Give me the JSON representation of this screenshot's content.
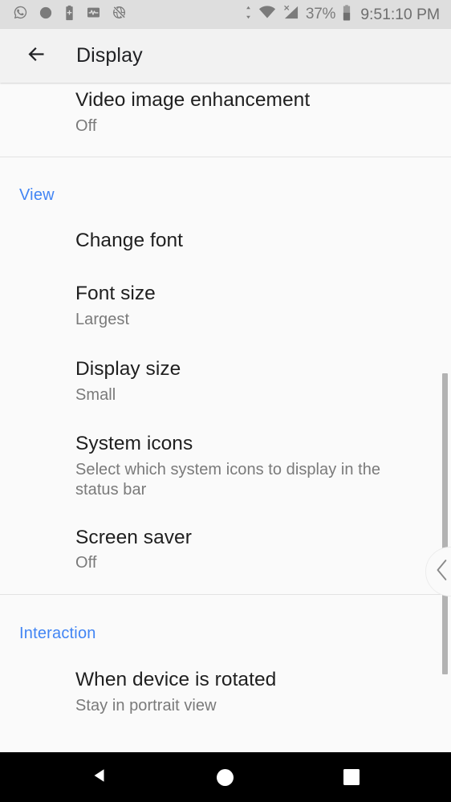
{
  "status_bar": {
    "background_color": "#dedede",
    "icon_color": "#7b7b7b",
    "left_icons": [
      {
        "name": "whatsapp-icon",
        "label": "WhatsApp"
      },
      {
        "name": "circle-icon",
        "label": "Notification"
      },
      {
        "name": "battery-plus-icon",
        "label": "Battery saver"
      },
      {
        "name": "activity-pulse-icon",
        "label": "Activity monitor"
      },
      {
        "name": "globe-off-icon",
        "label": "No internet"
      }
    ],
    "right_icons": [
      {
        "name": "data-transfer-icon",
        "label": "Data transfer"
      },
      {
        "name": "wifi-icon",
        "label": "Wi-Fi"
      },
      {
        "name": "cellular-signal-off-icon",
        "label": "No signal"
      },
      {
        "name": "battery-icon",
        "label": "Battery"
      }
    ],
    "battery_percent": "37%",
    "clock": "9:51:10 PM"
  },
  "app_bar": {
    "title": "Display",
    "back_icon": "arrow-left-icon",
    "background_color": "#f2f2f2"
  },
  "accent_color": "#4285f4",
  "content": {
    "partial_item": {
      "title": "Video image enhancement",
      "summary": "Off"
    },
    "sections": [
      {
        "header": "View",
        "items": [
          {
            "title": "Change font",
            "summary": ""
          },
          {
            "title": "Font size",
            "summary": "Largest"
          },
          {
            "title": "Display size",
            "summary": "Small"
          },
          {
            "title": "System icons",
            "summary": "Select which system icons to display in the status bar"
          },
          {
            "title": "Screen saver",
            "summary": "Off"
          }
        ]
      },
      {
        "header": "Interaction",
        "items": [
          {
            "title": "When device is rotated",
            "summary": "Stay in portrait view"
          }
        ]
      }
    ]
  },
  "edge_panel": {
    "handle_icon": "chevron-left-icon"
  },
  "scrollbar": {
    "thumb_color": "#b3b3b3"
  },
  "nav_bar": {
    "background_color": "#000000",
    "buttons": [
      {
        "name": "nav-back-button",
        "icon": "triangle-left-icon",
        "label": "Back"
      },
      {
        "name": "nav-home-button",
        "icon": "circle-icon",
        "label": "Home"
      },
      {
        "name": "nav-recents-button",
        "icon": "square-icon",
        "label": "Recents"
      }
    ]
  }
}
